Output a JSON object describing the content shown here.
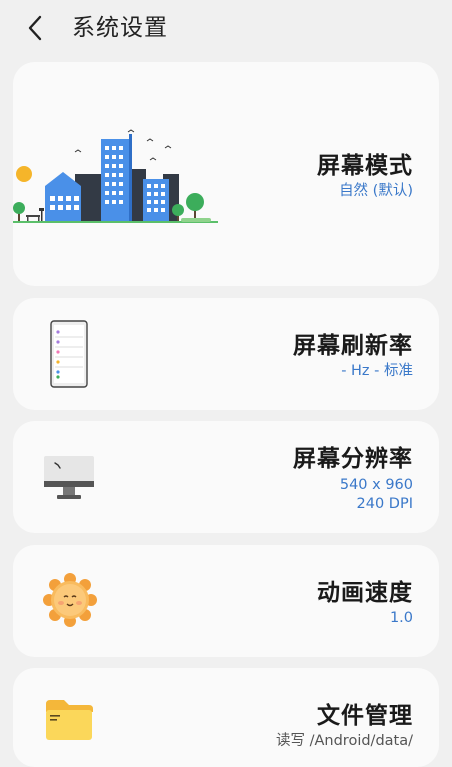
{
  "header": {
    "title": "系统设置",
    "back_icon": "chevron-left-icon"
  },
  "cards": [
    {
      "id": "screen-mode",
      "title": "屏幕模式",
      "subtitle": "自然 (默认)",
      "icon": "city-illustration-icon"
    },
    {
      "id": "refresh-rate",
      "title": "屏幕刷新率",
      "subtitle": "- Hz - 标准",
      "icon": "phone-icon"
    },
    {
      "id": "resolution",
      "title": "屏幕分辨率",
      "subtitle_lines": [
        "540 x 960",
        "240 DPI"
      ],
      "icon": "monitor-icon"
    },
    {
      "id": "animation-speed",
      "title": "动画速度",
      "subtitle": "1.0",
      "icon": "sun-face-icon"
    },
    {
      "id": "file-manager",
      "title": "文件管理",
      "subtitle": "读写 /Android/data/",
      "icon": "folder-icon"
    }
  ],
  "colors": {
    "accent": "#3a78c9",
    "background": "#f0f0f0",
    "card": "#fafafa"
  }
}
